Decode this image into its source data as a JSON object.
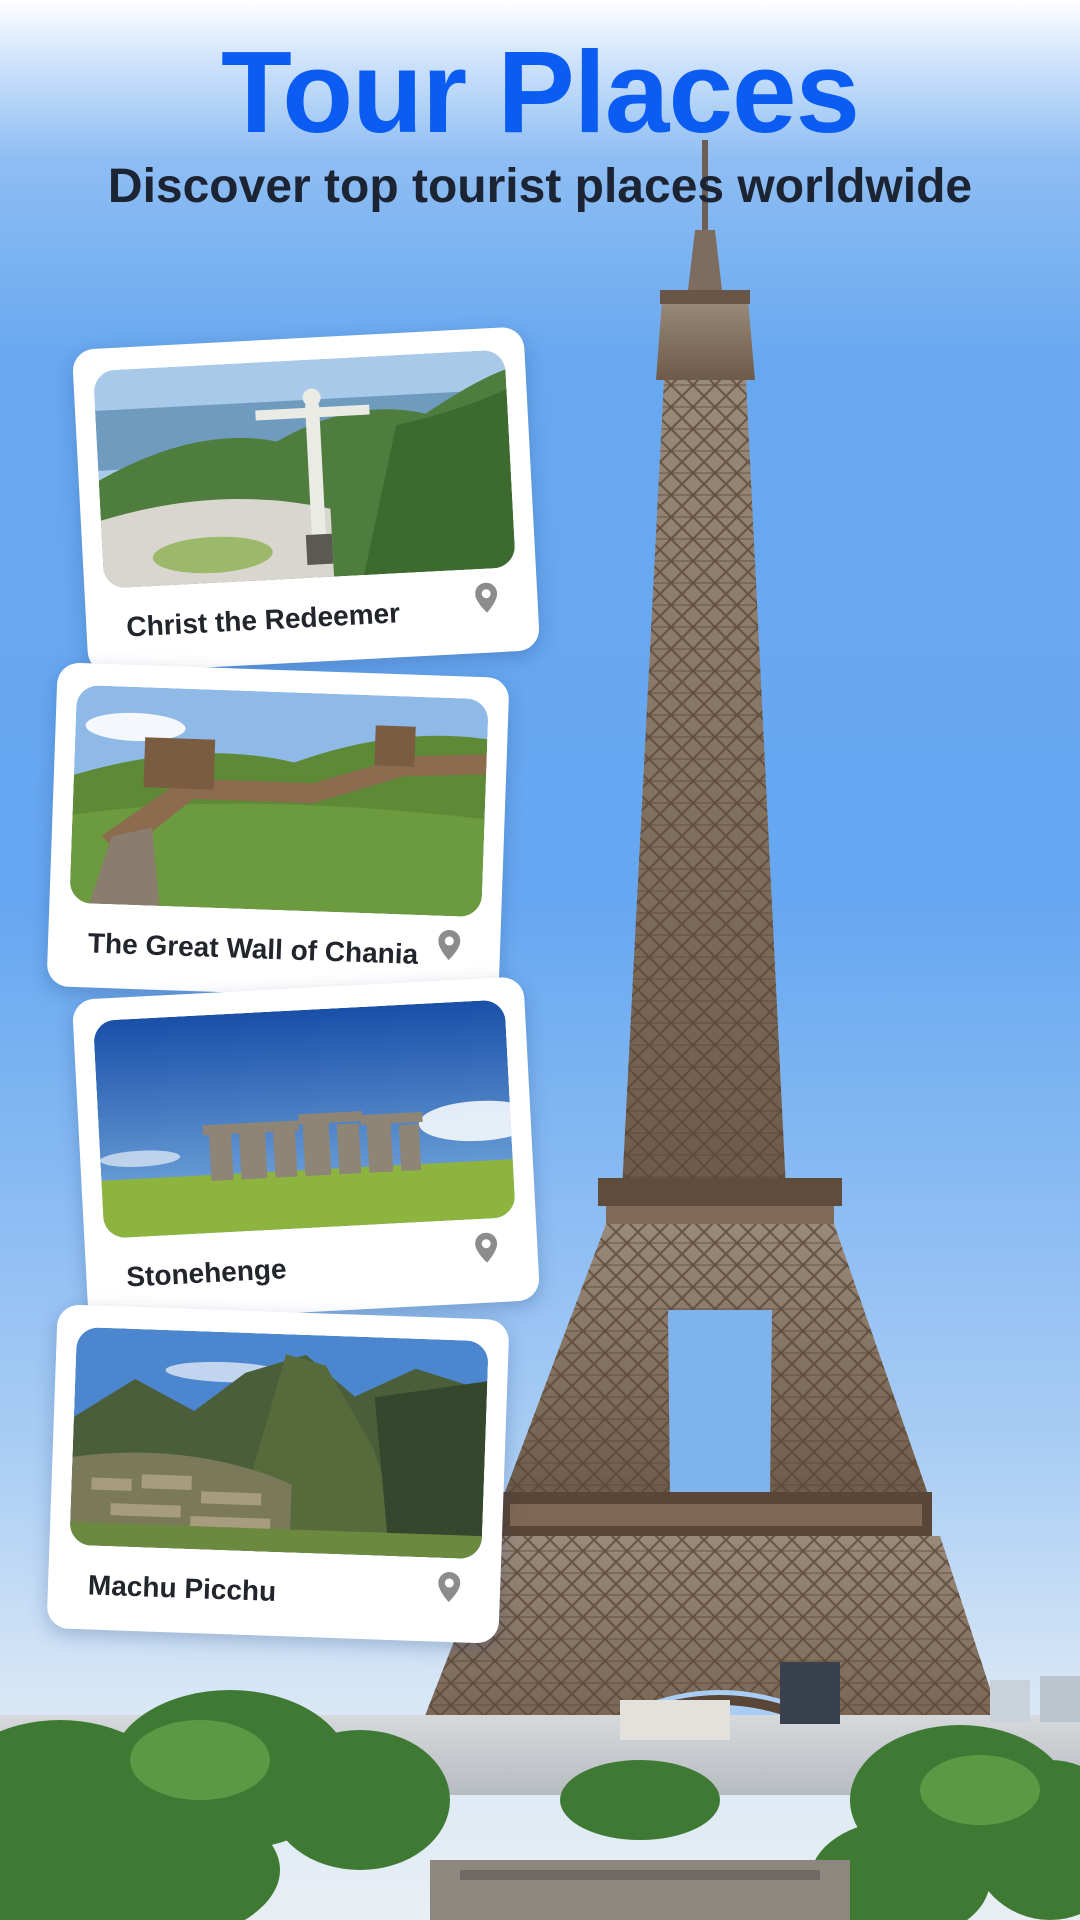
{
  "header": {
    "title": "Tour Places",
    "subtitle": "Discover top tourist places worldwide"
  },
  "colors": {
    "title": "#0a5cf2",
    "subtitle": "#1c2433",
    "card_background": "#ffffff",
    "pin": "#8c8c8c"
  },
  "cards": [
    {
      "label": "Christ the Redeemer",
      "icon": "location-pin-icon"
    },
    {
      "label": "The Great Wall of Chania",
      "icon": "location-pin-icon"
    },
    {
      "label": "Stonehenge",
      "icon": "location-pin-icon"
    },
    {
      "label": "Machu Picchu",
      "icon": "location-pin-icon"
    }
  ]
}
